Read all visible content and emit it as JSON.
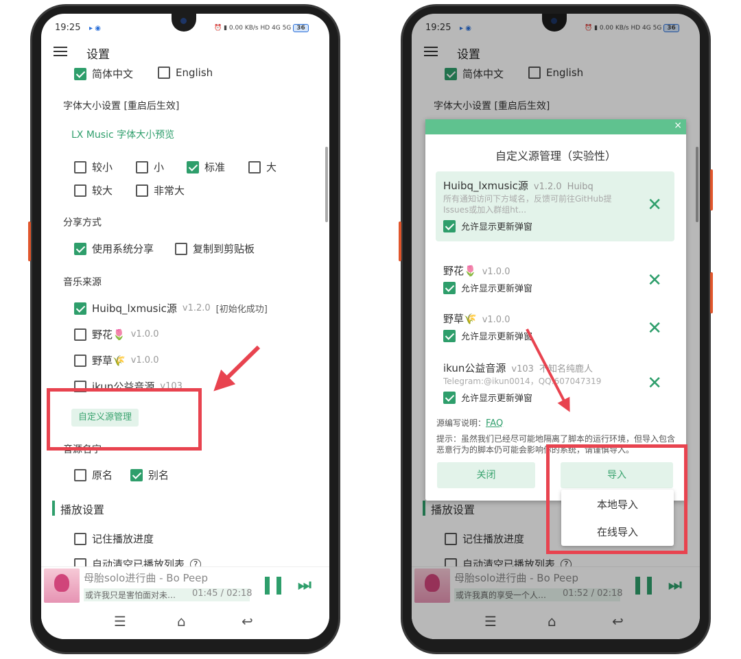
{
  "status": {
    "time": "19:25",
    "net_speed": "0.00 KB/s",
    "signal": "HD 4G 5G",
    "battery": "36"
  },
  "header": {
    "title": "设置"
  },
  "language": {
    "zh": "简体中文",
    "zh_checked": true,
    "en": "English",
    "en_checked": false
  },
  "font_size": {
    "label": "字体大小设置 [重启后生效]",
    "preview": "LX Music 字体大小预览",
    "options": [
      {
        "label": "较小",
        "checked": false
      },
      {
        "label": "小",
        "checked": false
      },
      {
        "label": "标准",
        "checked": true
      },
      {
        "label": "大",
        "checked": false
      },
      {
        "label": "较大",
        "checked": false
      },
      {
        "label": "非常大",
        "checked": false
      }
    ]
  },
  "share": {
    "label": "分享方式",
    "system": "使用系统分享",
    "system_checked": true,
    "clipboard": "复制到剪贴板",
    "clipboard_checked": false
  },
  "music_source": {
    "label": "音乐来源",
    "items": [
      {
        "name": "Huibq_lxmusic源",
        "version": "v1.2.0",
        "status": "[初始化成功]",
        "checked": true
      },
      {
        "name": "野花🌷",
        "version": "v1.0.0",
        "checked": false
      },
      {
        "name": "野草🌾",
        "version": "v1.0.0",
        "checked": false
      },
      {
        "name": "ikun公益音源",
        "version": "v103",
        "checked": false
      }
    ],
    "custom_button": "自定义源管理"
  },
  "source_name": {
    "label": "音源名字",
    "original": "原名",
    "alias": "别名",
    "alias_checked": true
  },
  "playback": {
    "label": "播放设置",
    "remember": "记住播放进度",
    "auto_clear": "自动清空已播放列表",
    "help": "?"
  },
  "player_left": {
    "title": "母胎solo进行曲 - Bo Peep",
    "lyric": "或许我只是害怕面对未…",
    "time": "01:45 / 02:18"
  },
  "player_right": {
    "title": "母胎solo进行曲 - Bo Peep",
    "lyric": "或许我真的享受一个人…",
    "time": "01:52 / 02:18"
  },
  "dialog": {
    "close_x": "×",
    "title": "自定义源管理（实验性）",
    "allow_update": "允许显示更新弹窗",
    "items": [
      {
        "name": "Huibq_lxmusic源",
        "version": "v1.2.0",
        "author": "Huibq",
        "desc": "所有通知访问下方域名，反馈可前往GitHub提Issues或加入群组ht...",
        "allow_checked": true
      },
      {
        "name": "野花🌷",
        "version": "v1.0.0",
        "allow_checked": true
      },
      {
        "name": "野草🌾",
        "version": "v1.0.0",
        "allow_checked": true
      },
      {
        "name": "ikun公益音源",
        "version": "v103",
        "author": "不知名纯鹿人",
        "desc": "Telegram:@ikun0014，QQ:607047319",
        "allow_checked": true
      }
    ],
    "faq_label": "源编写说明：",
    "faq_link": "FAQ",
    "tip": "提示：虽然我们已经尽可能地隔离了脚本的运行环境，但导入包含恶意行为的脚本仍可能会影响你的系统，请谨慎导入。",
    "close_button": "关闭",
    "import_button": "导入",
    "import_menu": [
      "本地导入",
      "在线导入"
    ]
  },
  "nav": {
    "menu": "☰",
    "home": "⌂",
    "back": "↩"
  },
  "colors": {
    "accent": "#2e9e6b",
    "annotation": "#e8434f"
  }
}
